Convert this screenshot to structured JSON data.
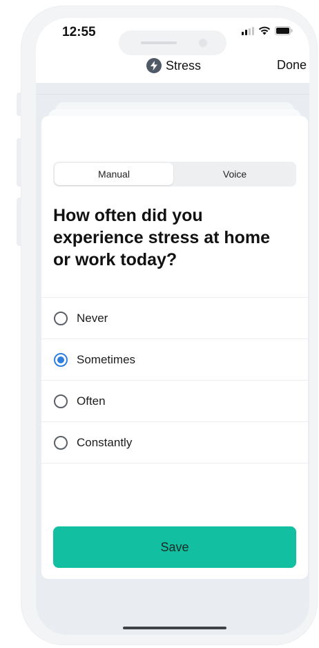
{
  "status_bar": {
    "time": "12:55"
  },
  "nav": {
    "title": "Stress",
    "title_icon": "lightning-bolt-icon",
    "done_label": "Done"
  },
  "segmented": {
    "options": [
      "Manual",
      "Voice"
    ],
    "selected": "Manual"
  },
  "question": "How often did you experience stress at home or work today?",
  "answers": {
    "items": [
      {
        "label": "Never",
        "selected": false
      },
      {
        "label": "Sometimes",
        "selected": true
      },
      {
        "label": "Often",
        "selected": false
      },
      {
        "label": "Constantly",
        "selected": false
      }
    ]
  },
  "save_label": "Save",
  "colors": {
    "accent": "#12bfa0",
    "radio_selected": "#2f7fe0"
  }
}
